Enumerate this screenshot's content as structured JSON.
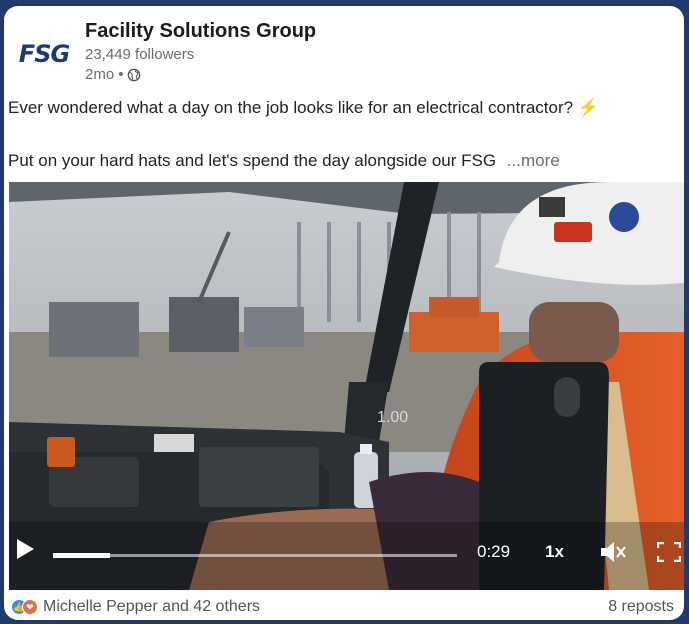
{
  "post": {
    "company_name": "Facility Solutions Group",
    "logo_text": "FSG",
    "followers": "23,449 followers",
    "age": "2mo",
    "separator": "•",
    "text_line1": "Ever wondered what a day on the job looks like for an electrical contractor?",
    "text_line2": "Put on your hard hats and let's spend the day alongside our FSG",
    "more_label": "...more",
    "bolt_emoji": "⚡"
  },
  "video": {
    "overlay_value": "1.00",
    "time": "0:29",
    "speed": "1x",
    "progress_fraction": 0.14,
    "play_icon": "play-icon",
    "mute_icon": "muted-speaker-icon",
    "fullscreen_icon": "fullscreen-icon"
  },
  "footer": {
    "reactions_text": "Michelle Pepper and 42 others",
    "reposts_text": "8 reposts"
  },
  "colors": {
    "background": "#1f3a6b",
    "logo": "#1d3a78",
    "bolt": "#f5b400",
    "like": "#378fe9",
    "love": "#df704d",
    "vest_orange": "#e0541f"
  }
}
